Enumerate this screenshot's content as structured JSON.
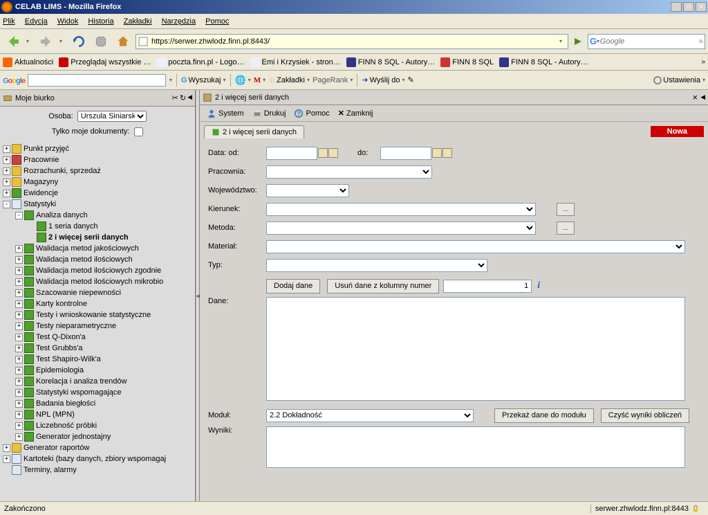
{
  "window": {
    "title": "CELAB LIMS - Mozilla Firefox"
  },
  "menu": [
    "Plik",
    "Edycja",
    "Widok",
    "Historia",
    "Zakładki",
    "Narzędzia",
    "Pomoc"
  ],
  "url": "https://serwer.zhwlodz.finn.pl:8443/",
  "search_placeholder": "Google",
  "bookmarks": [
    "Aktualności",
    "Przeglądaj wszystkie …",
    "poczta.finn.pl - Logo…",
    "Emi i Krzysiek - stron…",
    "FINN 8 SQL - Autory…",
    "FINN 8 SQL",
    "FINN 8 SQL - Autory…"
  ],
  "googlebar": {
    "wyszukaj": "Wyszukaj",
    "zakladki": "Zakładki",
    "pagerank": "PageRank",
    "wyslij": "Wyślij do",
    "ustawienia": "Ustawienia"
  },
  "sidebar": {
    "title": "Moje biurko",
    "osoba_label": "Osoba:",
    "osoba_value": "Urszula Siniarska",
    "docs_label": "Tylko moje dokumenty:"
  },
  "tree": [
    {
      "l": 0,
      "t": "+",
      "ico": "yellow",
      "label": "Punkt przyjęć"
    },
    {
      "l": 0,
      "t": "+",
      "ico": "red",
      "label": "Pracownie"
    },
    {
      "l": 0,
      "t": "+",
      "ico": "yellow",
      "label": "Rozrachunki, sprzedaż"
    },
    {
      "l": 0,
      "t": "+",
      "ico": "yellow",
      "label": "Magazyny"
    },
    {
      "l": 0,
      "t": "+",
      "ico": "green",
      "label": "Ewidencje"
    },
    {
      "l": 0,
      "t": "-",
      "ico": "doc",
      "label": "Statystyki"
    },
    {
      "l": 1,
      "t": "-",
      "ico": "green",
      "label": "Analiza danych"
    },
    {
      "l": 2,
      "t": "",
      "ico": "green",
      "label": "1 seria danych"
    },
    {
      "l": 2,
      "t": "",
      "ico": "green",
      "label": "2 i więcej serii danych",
      "sel": true
    },
    {
      "l": 1,
      "t": "+",
      "ico": "green",
      "label": "Walidacja metod jakościowych"
    },
    {
      "l": 1,
      "t": "+",
      "ico": "green",
      "label": "Walidacja metod ilościowych"
    },
    {
      "l": 1,
      "t": "+",
      "ico": "green",
      "label": "Walidacja metod ilościowych zgodnie"
    },
    {
      "l": 1,
      "t": "+",
      "ico": "green",
      "label": "Walidacja metod ilościowych mikrobio"
    },
    {
      "l": 1,
      "t": "+",
      "ico": "green",
      "label": "Szacowanie niepewności"
    },
    {
      "l": 1,
      "t": "+",
      "ico": "green",
      "label": "Karty kontrolne"
    },
    {
      "l": 1,
      "t": "+",
      "ico": "green",
      "label": "Testy i wnioskowanie statystyczne"
    },
    {
      "l": 1,
      "t": "+",
      "ico": "green",
      "label": "Testy nieparametryczne"
    },
    {
      "l": 1,
      "t": "+",
      "ico": "green",
      "label": "Test Q-Dixon'a"
    },
    {
      "l": 1,
      "t": "+",
      "ico": "green",
      "label": "Test Grubbs'a"
    },
    {
      "l": 1,
      "t": "+",
      "ico": "green",
      "label": "Test Shapiro-Wilk'a"
    },
    {
      "l": 1,
      "t": "+",
      "ico": "green",
      "label": "Epidemiologia"
    },
    {
      "l": 1,
      "t": "+",
      "ico": "green",
      "label": "Korelacja i analiza trendów"
    },
    {
      "l": 1,
      "t": "+",
      "ico": "green",
      "label": "Statystyki wspomagające"
    },
    {
      "l": 1,
      "t": "+",
      "ico": "green",
      "label": "Badania biegłości"
    },
    {
      "l": 1,
      "t": "+",
      "ico": "green",
      "label": "NPL (MPN)"
    },
    {
      "l": 1,
      "t": "+",
      "ico": "green",
      "label": "Liczebność próbki"
    },
    {
      "l": 1,
      "t": "+",
      "ico": "green",
      "label": "Generator jednostajny"
    },
    {
      "l": 0,
      "t": "+",
      "ico": "yellow",
      "label": "Generator raportów"
    },
    {
      "l": 0,
      "t": "+",
      "ico": "doc",
      "label": "Kartoteki (bazy danych, zbiory wspomagaj"
    },
    {
      "l": 0,
      "t": "",
      "ico": "doc",
      "label": "Terminy, alarmy"
    }
  ],
  "content": {
    "header": "2 i więcej serii danych",
    "toolbar": {
      "system": "System",
      "drukuj": "Drukuj",
      "pomoc": "Pomoc",
      "zamknij": "Zamknij"
    },
    "tab": "2 i więcej serii danych",
    "nowa": "Nowa",
    "form": {
      "data_od": "Data: od:",
      "do": "do:",
      "pracownia": "Pracownia:",
      "woj": "Województwo:",
      "kierunek": "Kierunek:",
      "metoda": "Metoda:",
      "material": "Materiał:",
      "typ": "Typ:",
      "dodaj": "Dodaj dane",
      "usun": "Usuń dane z kolumny numer",
      "col_num": "1",
      "dane": "Dane:",
      "modul": "Moduł:",
      "modul_val": "2.2 Dokładność",
      "przekaz": "Przekaż dane do modułu",
      "czysc": "Czyść wyniki obliczeń",
      "wyniki": "Wyniki:"
    }
  },
  "status": {
    "left": "Zakończono",
    "right": "serwer.zhwlodz.finn.pl:8443"
  }
}
